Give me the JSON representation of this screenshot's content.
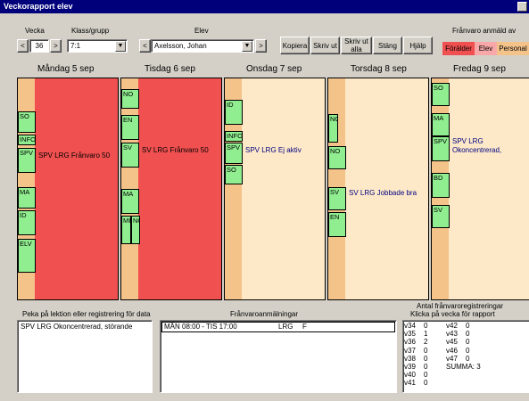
{
  "window": {
    "title": "Veckorapport elev"
  },
  "toolbar": {
    "vecka_label": "Vecka",
    "week_value": "36",
    "prev_week": "<",
    "next_week": ">",
    "klass_label": "Klass/grupp",
    "klass_value": "7:1",
    "elev_label": "Elev",
    "elev_prev": "<",
    "elev_value": "Axelsson, Johan",
    "elev_next": ">",
    "buttons": {
      "kopiera": "Kopiera",
      "skriv_ut": "Skriv ut",
      "skriv_ut_alla": "Skriv ut alla",
      "stang": "Stäng",
      "hjalp": "Hjälp"
    },
    "franvaro_label": "Frånvaro anmäld av",
    "legend": [
      {
        "label": "Förälder",
        "color": "#f15050"
      },
      {
        "label": "Elev",
        "color": "#f8a8a8"
      },
      {
        "label": "Personal",
        "color": "#f4c38a"
      }
    ]
  },
  "days": [
    {
      "name": "Måndag 5 sep",
      "style": "red",
      "blocks": [
        "SO",
        "INFO",
        "SPV",
        "MA",
        "ID",
        "ELV"
      ],
      "registration": "SPV LRG Frånvaro 50"
    },
    {
      "name": "Tisdag 6 sep",
      "style": "red",
      "blocks": [
        "NO",
        "EN",
        "SV",
        "MA",
        "MI",
        "NG"
      ],
      "registration": "SV LRG Frånvaro 50"
    },
    {
      "name": "Onsdag 7 sep",
      "style": "cream",
      "blocks": [
        "ID",
        "INFO",
        "SPV",
        "SO"
      ],
      "registration": "SPV LRG Ej aktiv"
    },
    {
      "name": "Torsdag 8 sep",
      "style": "cream",
      "blocks": [
        "NO",
        "NO",
        "SV",
        "EN"
      ],
      "registration": "SV LRG Jobbade bra"
    },
    {
      "name": "Fredag 9 sep",
      "style": "cream",
      "blocks": [
        "SO",
        "MA",
        "SPV",
        "BD",
        "SV"
      ],
      "registration": "SPV LRG Okoncentrerad,"
    }
  ],
  "bottom": {
    "lesson_label": "Peka på lektion eller registrering för data",
    "lesson_text": "SPV LRG  Okoncentrerad,  störande",
    "franvaro_label": "Frånvaroanmälningar",
    "franvaro_row": {
      "period": "MÅN 08:00 - TIS 17:00",
      "type": "LRG",
      "code": "F"
    },
    "stats_label_1": "Antal frånvaroregistreringar",
    "stats_label_2": "Klicka på vecka för rapport",
    "weeks_left": [
      {
        "week": "v34",
        "count": "0"
      },
      {
        "week": "v35",
        "count": "1"
      },
      {
        "week": "v36",
        "count": "2"
      },
      {
        "week": "v37",
        "count": "0"
      },
      {
        "week": "v38",
        "count": "0"
      },
      {
        "week": "v39",
        "count": "0"
      },
      {
        "week": "v40",
        "count": "0"
      },
      {
        "week": "v41",
        "count": "0"
      }
    ],
    "weeks_right": [
      {
        "week": "v42",
        "count": "0"
      },
      {
        "week": "v43",
        "count": "0"
      },
      {
        "week": "v45",
        "count": "0"
      },
      {
        "week": "v46",
        "count": "0"
      },
      {
        "week": "v47",
        "count": "0"
      }
    ],
    "summa": "SUMMA:  3"
  }
}
